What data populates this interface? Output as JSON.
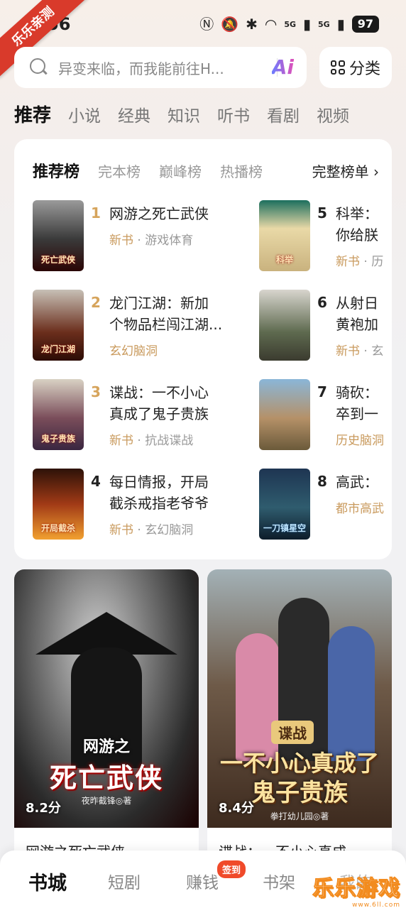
{
  "status_bar": {
    "time": "56",
    "battery": "97",
    "network": "5G"
  },
  "ribbon": {
    "text": "乐乐亲测"
  },
  "search": {
    "placeholder": "异变来临，而我能前往H...",
    "ai_label": "Ai"
  },
  "category_button": {
    "label": "分类"
  },
  "nav_tabs": [
    "推荐",
    "小说",
    "经典",
    "知识",
    "听书",
    "看剧",
    "视频"
  ],
  "ranking": {
    "tabs": [
      "推荐榜",
      "完本榜",
      "巅峰榜",
      "热播榜"
    ],
    "full_list": "完整榜单 ›",
    "items": [
      {
        "rank": "1",
        "title": "网游之死亡武侠",
        "title2": "",
        "meta_tag": "新书",
        "meta_rest": " · 游戏体育",
        "cover_text": "死亡武侠"
      },
      {
        "rank": "2",
        "title": "龙门江湖：新加",
        "title2": "个物品栏闯江湖...",
        "meta_tag": "玄幻脑洞",
        "meta_rest": "",
        "cover_text": "龙门江湖"
      },
      {
        "rank": "3",
        "title": "谍战：一不小心",
        "title2": "真成了鬼子贵族",
        "meta_tag": "新书",
        "meta_rest": " · 抗战谍战",
        "cover_text": "鬼子贵族"
      },
      {
        "rank": "4",
        "title": "每日情报，开局",
        "title2": "截杀戒指老爷爷",
        "meta_tag": "新书",
        "meta_rest": " · 玄幻脑洞",
        "cover_text": "开局截杀"
      },
      {
        "rank": "5",
        "title": "科举：",
        "title2": "你给朕",
        "meta_tag": "新书",
        "meta_rest": " · 历",
        "cover_text": "科举"
      },
      {
        "rank": "6",
        "title": "从射日",
        "title2": "黄袍加",
        "meta_tag": "新书",
        "meta_rest": " · 玄",
        "cover_text": ""
      },
      {
        "rank": "7",
        "title": "骑砍：",
        "title2": "卒到一",
        "meta_tag": "历史脑洞",
        "meta_rest": "",
        "cover_text": ""
      },
      {
        "rank": "8",
        "title": "高武：",
        "title2": "",
        "meta_tag": "都市高武",
        "meta_rest": "",
        "cover_text": "一刀镇星空"
      }
    ]
  },
  "feed": [
    {
      "score": "8.2分",
      "cover_sub": "网游之",
      "cover_title": "死亡武侠",
      "cover_author": "夜昨截锋◎著",
      "title": "网游之死亡武侠"
    },
    {
      "score": "8.4分",
      "cover_badge": "谍战",
      "cover_title": "一不小心真成了",
      "cover_title2": "鬼子贵族",
      "cover_author": "拳打幼儿园◎著",
      "title": "谍战：一不小心真成"
    }
  ],
  "bottom_nav": [
    "书城",
    "短剧",
    "赚钱",
    "书架",
    "我的"
  ],
  "sign_badge": "签到",
  "watermark": {
    "main": "乐乐游戏",
    "url": "www.6ll.com"
  },
  "colors": {
    "accent": "#c99a5d",
    "rank_top": "#d6a45c",
    "rank_other": "#222222",
    "badge": "#f04a2a"
  }
}
